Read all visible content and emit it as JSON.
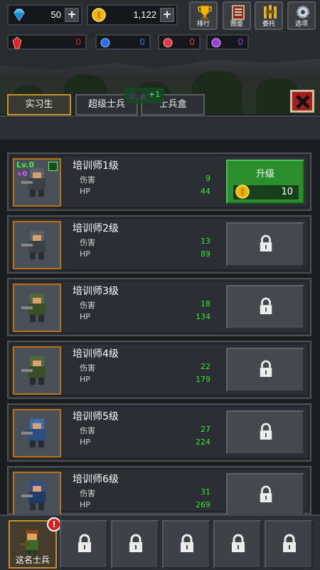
{
  "resources": {
    "gems": {
      "value": "50",
      "icon": "diamond-icon"
    },
    "coins": {
      "value": "1,122",
      "icon": "coin-icon"
    },
    "plus": "+"
  },
  "menu": [
    {
      "label": "排行",
      "icon": "trophy-icon"
    },
    {
      "label": "图鉴",
      "icon": "book-icon"
    },
    {
      "label": "委托",
      "icon": "banner-icon"
    },
    {
      "label": "选项",
      "icon": "gear-icon"
    }
  ],
  "gems_row": [
    {
      "color": "#d62828",
      "value": "0"
    },
    {
      "color": "#2f6fe8",
      "value": "0"
    },
    {
      "color": "#e23a4a",
      "value": "0"
    },
    {
      "color": "#9b3fd8",
      "value": "0"
    }
  ],
  "tabs": [
    {
      "label": "实习生",
      "active": true
    },
    {
      "label": "超级士兵",
      "active": false
    },
    {
      "label": "士兵盒",
      "active": false
    }
  ],
  "boost": {
    "text": "+1"
  },
  "stat_labels": {
    "damage": "伤害",
    "hp": "HP"
  },
  "upgrade": {
    "label": "升级",
    "cost": "10"
  },
  "level": {
    "lv": "Lv.0",
    "plus": "+0"
  },
  "trainers": [
    {
      "title": "培训师1级",
      "damage": "9",
      "hp": "44",
      "unlocked": true
    },
    {
      "title": "培训师2级",
      "damage": "13",
      "hp": "89",
      "unlocked": false
    },
    {
      "title": "培训师3级",
      "damage": "18",
      "hp": "134",
      "unlocked": false
    },
    {
      "title": "培训师4级",
      "damage": "22",
      "hp": "179",
      "unlocked": false
    },
    {
      "title": "培训师5级",
      "damage": "27",
      "hp": "224",
      "unlocked": false
    },
    {
      "title": "培训师6级",
      "damage": "31",
      "hp": "269",
      "unlocked": false
    }
  ],
  "bottom": {
    "selected_label": "这名士兵",
    "alert": "!",
    "locked_slots": 5
  },
  "colors": {
    "accent": "#c7902d",
    "green": "#2a8f2c",
    "stat": "#35e835"
  }
}
